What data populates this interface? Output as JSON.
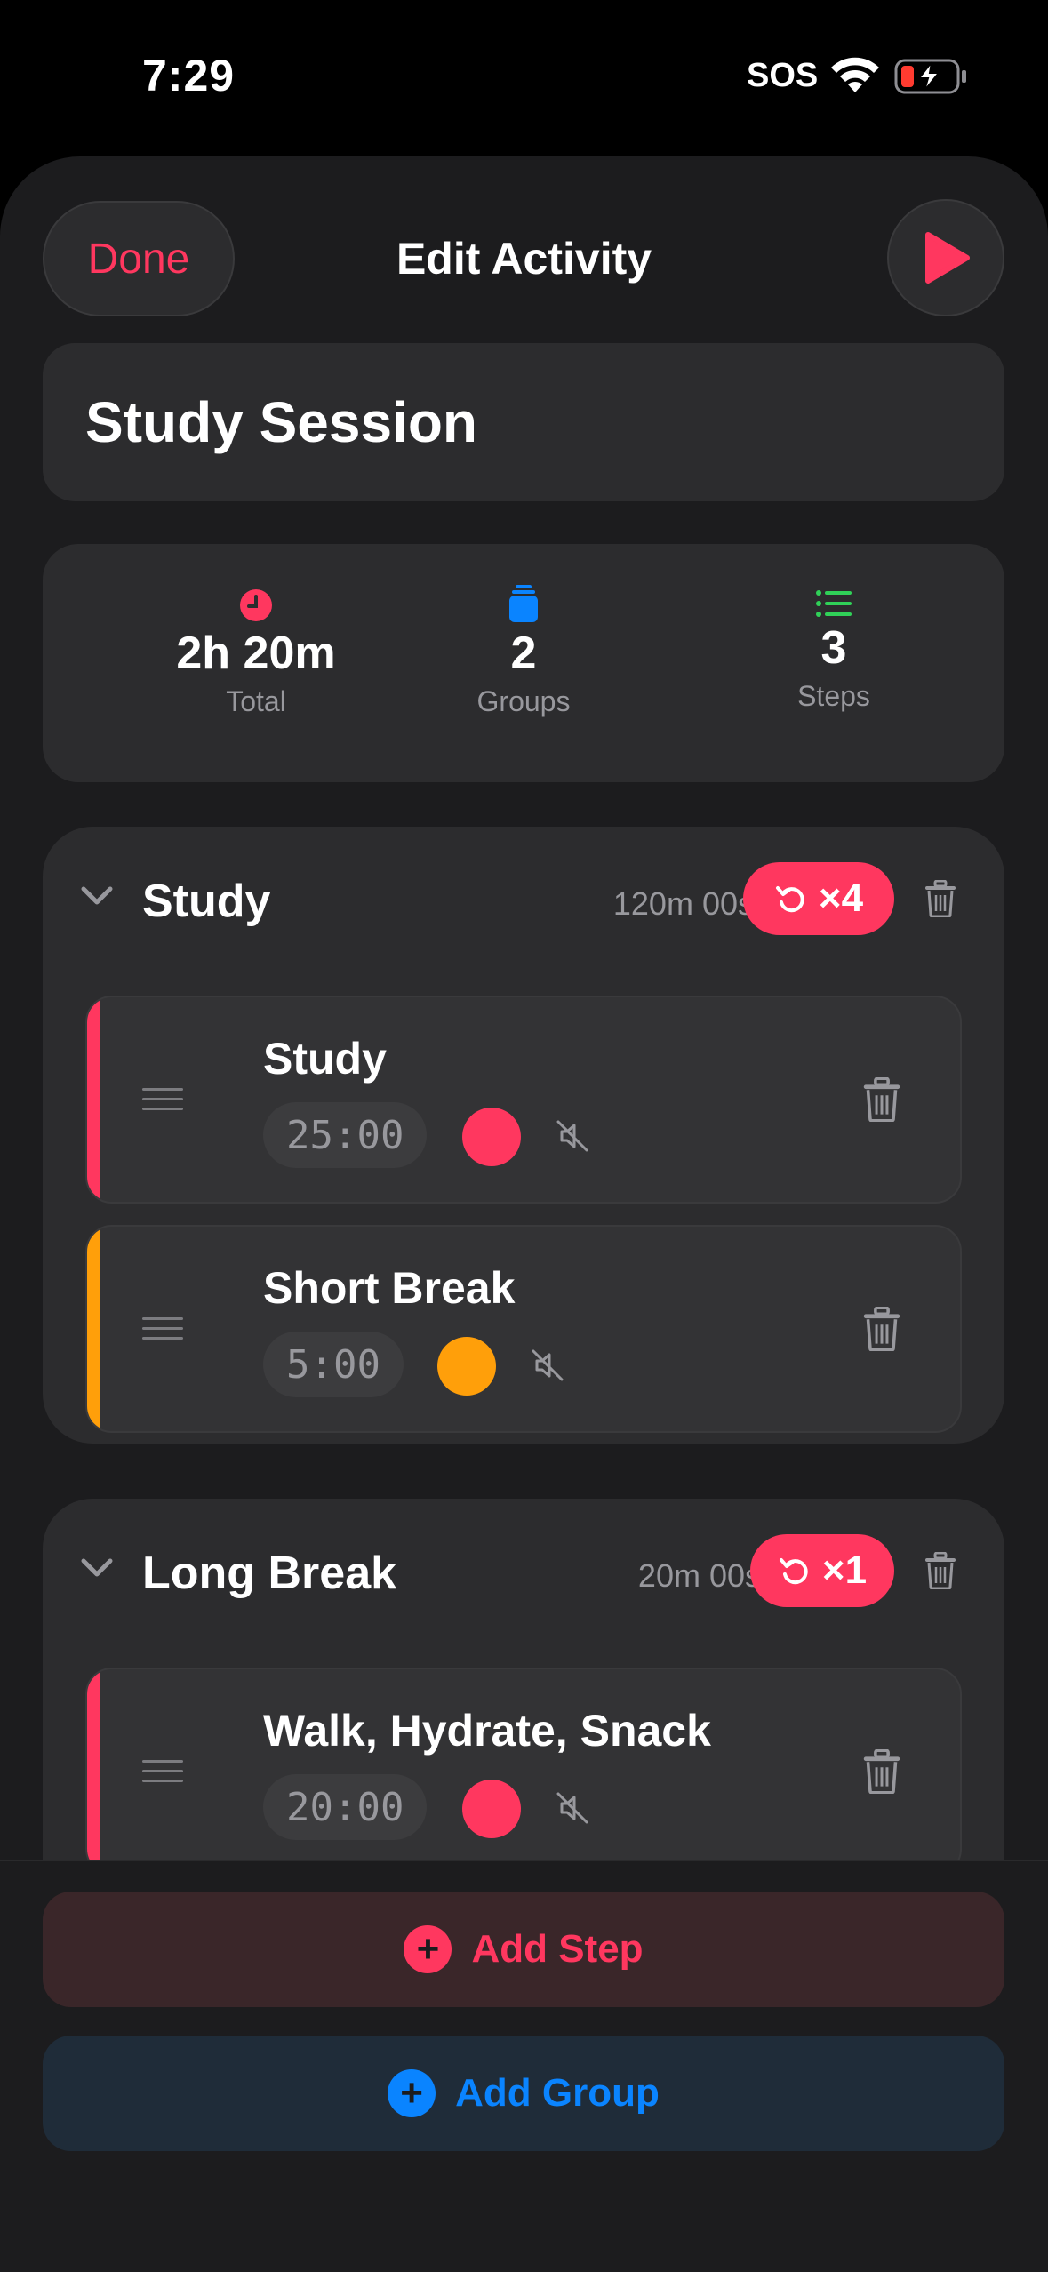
{
  "status_bar": {
    "time": "7:29",
    "carrier": "SOS",
    "icons": [
      "wifi-icon",
      "battery-charging-icon"
    ]
  },
  "nav": {
    "done_label": "Done",
    "title": "Edit Activity",
    "play_icon": "play-icon"
  },
  "activity": {
    "name": "Study Session"
  },
  "stats": {
    "total": {
      "value": "2h 20m",
      "label": "Total",
      "icon": "clock-icon",
      "color": "#ff375f"
    },
    "groups": {
      "value": "2",
      "label": "Groups",
      "icon": "stack-icon",
      "color": "#0a84ff"
    },
    "steps": {
      "value": "3",
      "label": "Steps",
      "icon": "list-icon",
      "color": "#30d158"
    }
  },
  "groups": [
    {
      "name": "Study",
      "duration": "120m 00s",
      "repeat": "×4",
      "steps": [
        {
          "name": "Study",
          "time": "25:00",
          "color": "#ff375f"
        },
        {
          "name": "Short Break",
          "time": "5:00",
          "color": "#ff9f0a"
        }
      ]
    },
    {
      "name": "Long Break",
      "duration": "20m 00s",
      "repeat": "×1",
      "steps": [
        {
          "name": "Walk, Hydrate, Snack",
          "time": "20:00",
          "color": "#ff375f"
        }
      ]
    }
  ],
  "actions": {
    "add_step": "Add Step",
    "add_group": "Add Group"
  },
  "colors": {
    "accent": "#ff375f",
    "blue": "#0a84ff",
    "green": "#30d158",
    "orange": "#ff9f0a"
  }
}
